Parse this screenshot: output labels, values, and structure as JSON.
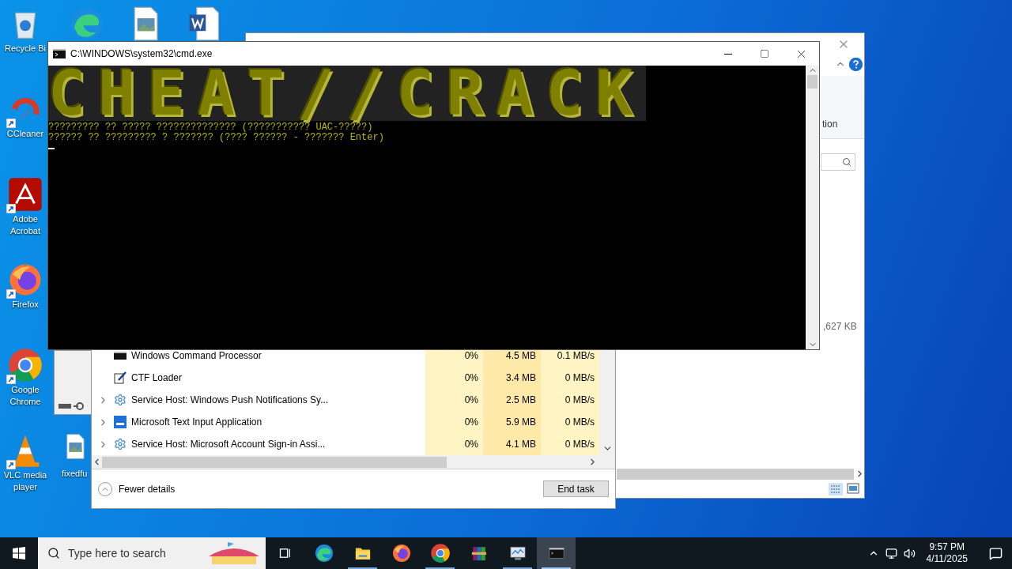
{
  "desktop_icons": [
    {
      "label": "Recycle Bi",
      "kind": "recycle",
      "shortcut": false
    },
    {
      "label": "CCleaner",
      "kind": "ccleaner",
      "shortcut": true
    },
    {
      "label": "Adobe Acrobat",
      "kind": "acrobat",
      "shortcut": true
    },
    {
      "label": "Firefox",
      "kind": "firefox",
      "shortcut": true
    },
    {
      "label": "Google Chrome",
      "kind": "chrome",
      "shortcut": true
    },
    {
      "label": "VLC media player",
      "kind": "vlc",
      "shortcut": true
    }
  ],
  "desktop_icons_2": [
    {
      "kind": "edge"
    },
    {
      "kind": "image"
    },
    {
      "kind": "word"
    }
  ],
  "desktop_file": {
    "label": "fixedfu",
    "kind": "image"
  },
  "explorer": {
    "ribbon_text": "tion",
    "status_size": ",627 KB"
  },
  "task_manager": {
    "rows": [
      {
        "name": "Windows Command Processor",
        "kind": "console",
        "expandable": false,
        "cpu": "0%",
        "memory": "4.5 MB",
        "network": "0.1 MB/s"
      },
      {
        "name": "CTF Loader",
        "kind": "pen",
        "expandable": false,
        "cpu": "0%",
        "memory": "3.4 MB",
        "network": "0 MB/s"
      },
      {
        "name": "Service Host: Windows Push Notifications Sy...",
        "kind": "gear",
        "expandable": true,
        "cpu": "0%",
        "memory": "2.5 MB",
        "network": "0 MB/s"
      },
      {
        "name": "Microsoft Text Input Application",
        "kind": "keyboard",
        "expandable": true,
        "cpu": "0%",
        "memory": "5.9 MB",
        "network": "0 MB/s"
      },
      {
        "name": "Service Host: Microsoft Account Sign-in Assi...",
        "kind": "gear",
        "expandable": true,
        "cpu": "0%",
        "memory": "4.1 MB",
        "network": "0 MB/s"
      }
    ],
    "fewer_details": "Fewer details",
    "end_task": "End task"
  },
  "cmd": {
    "title": "C:\\WINDOWS\\system32\\cmd.exe",
    "banner": "CHEAT//CRACK",
    "lines": [
      "????????? ?? ????? ?????????????? (??????????? UAC-?????)",
      "?????? ?? ????????? ? ??????? (???? ?????? - ??????? Enter)"
    ]
  },
  "taskbar": {
    "search_placeholder": "Type here to search",
    "apps": [
      {
        "kind": "task-view",
        "running": false,
        "active": false
      },
      {
        "kind": "edge",
        "running": false,
        "active": false
      },
      {
        "kind": "explorer",
        "running": true,
        "active": false
      },
      {
        "kind": "firefox",
        "running": false,
        "active": false
      },
      {
        "kind": "chrome",
        "running": true,
        "active": false
      },
      {
        "kind": "winrar",
        "running": false,
        "active": false
      },
      {
        "kind": "monitor",
        "running": true,
        "active": false
      },
      {
        "kind": "console",
        "running": true,
        "active": true
      }
    ],
    "time": "9:57 PM",
    "date": "4/11/2025"
  }
}
